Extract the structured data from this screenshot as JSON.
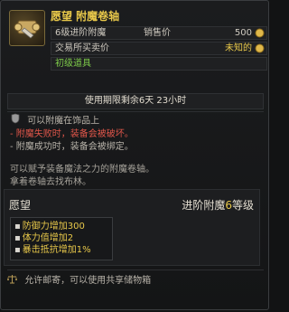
{
  "header": {
    "title": "愿望 附魔卷轴",
    "row1": {
      "label": "6级进阶附魔",
      "price_label": "销售价",
      "price_value": "500"
    },
    "row2": {
      "label": "交易所买卖价",
      "value": "未知的"
    },
    "row3": {
      "label": "初级道具"
    }
  },
  "limit": "使用期限剩余6天 23小时",
  "equip_note": "可以附魔在饰品上",
  "warnings": [
    "- 附魔失败时，装备会被破坏。",
    "- 附魔成功时，装备会被绑定。"
  ],
  "description": [
    "可以赋予装备魔法之力的附魔卷轴。",
    "拿着卷轴去找布林。"
  ],
  "enchant": {
    "name": "愿望",
    "level_prefix": "进阶附魔",
    "level_value": "6",
    "level_suffix": "等级",
    "options": [
      "防御力增加300",
      "体力值增加2",
      "暴击抵抗增加1%"
    ]
  },
  "footer": "允许邮寄，可以使用共享储物箱",
  "icons": {
    "item": "scroll-icon",
    "coin": "gold-coin-icon",
    "equip": "armor-icon",
    "mail": "scale-icon"
  },
  "colors": {
    "title": "#e8c84a",
    "warning": "#e0564a",
    "grade": "#7ecb4a"
  }
}
